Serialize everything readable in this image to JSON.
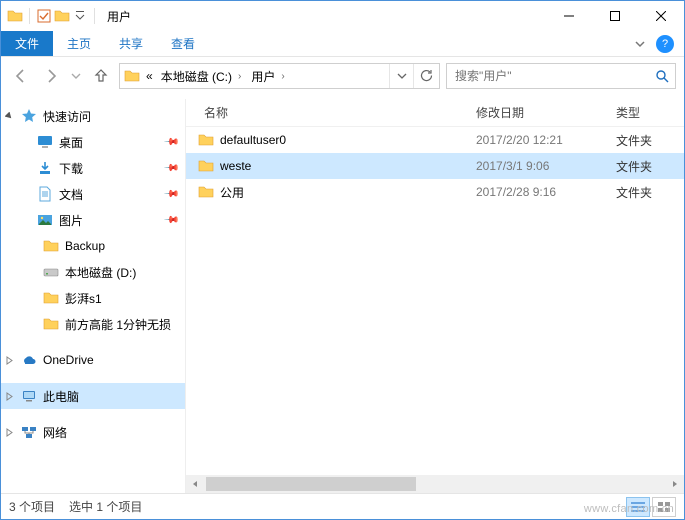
{
  "window": {
    "title": "用户"
  },
  "ribbon": {
    "tabs": {
      "file": "文件",
      "home": "主页",
      "share": "共享",
      "view": "查看"
    }
  },
  "address": {
    "prefix": "«",
    "segments": [
      "本地磁盘 (C:)",
      "用户"
    ]
  },
  "search": {
    "placeholder": "搜索\"用户\""
  },
  "navpane": {
    "quick_access": "快速访问",
    "items": [
      {
        "label": "桌面",
        "pinned": true
      },
      {
        "label": "下载",
        "pinned": true
      },
      {
        "label": "文档",
        "pinned": true
      },
      {
        "label": "图片",
        "pinned": true
      },
      {
        "label": "Backup",
        "pinned": false
      },
      {
        "label": "本地磁盘 (D:)",
        "pinned": false
      },
      {
        "label": "彭湃s1",
        "pinned": false
      },
      {
        "label": "前方高能 1分钟无损",
        "pinned": false
      }
    ],
    "onedrive": "OneDrive",
    "thispc": "此电脑",
    "network": "网络"
  },
  "columns": {
    "name": "名称",
    "date": "修改日期",
    "type": "类型"
  },
  "files": [
    {
      "name": "defaultuser0",
      "date": "2017/2/20 12:21",
      "type": "文件夹",
      "selected": false
    },
    {
      "name": "weste",
      "date": "2017/3/1 9:06",
      "type": "文件夹",
      "selected": true
    },
    {
      "name": "公用",
      "date": "2017/2/28 9:16",
      "type": "文件夹",
      "selected": false
    }
  ],
  "status": {
    "count": "3 个项目",
    "selection": "选中 1 个项目"
  },
  "watermark": "www.cfan.com.cn"
}
